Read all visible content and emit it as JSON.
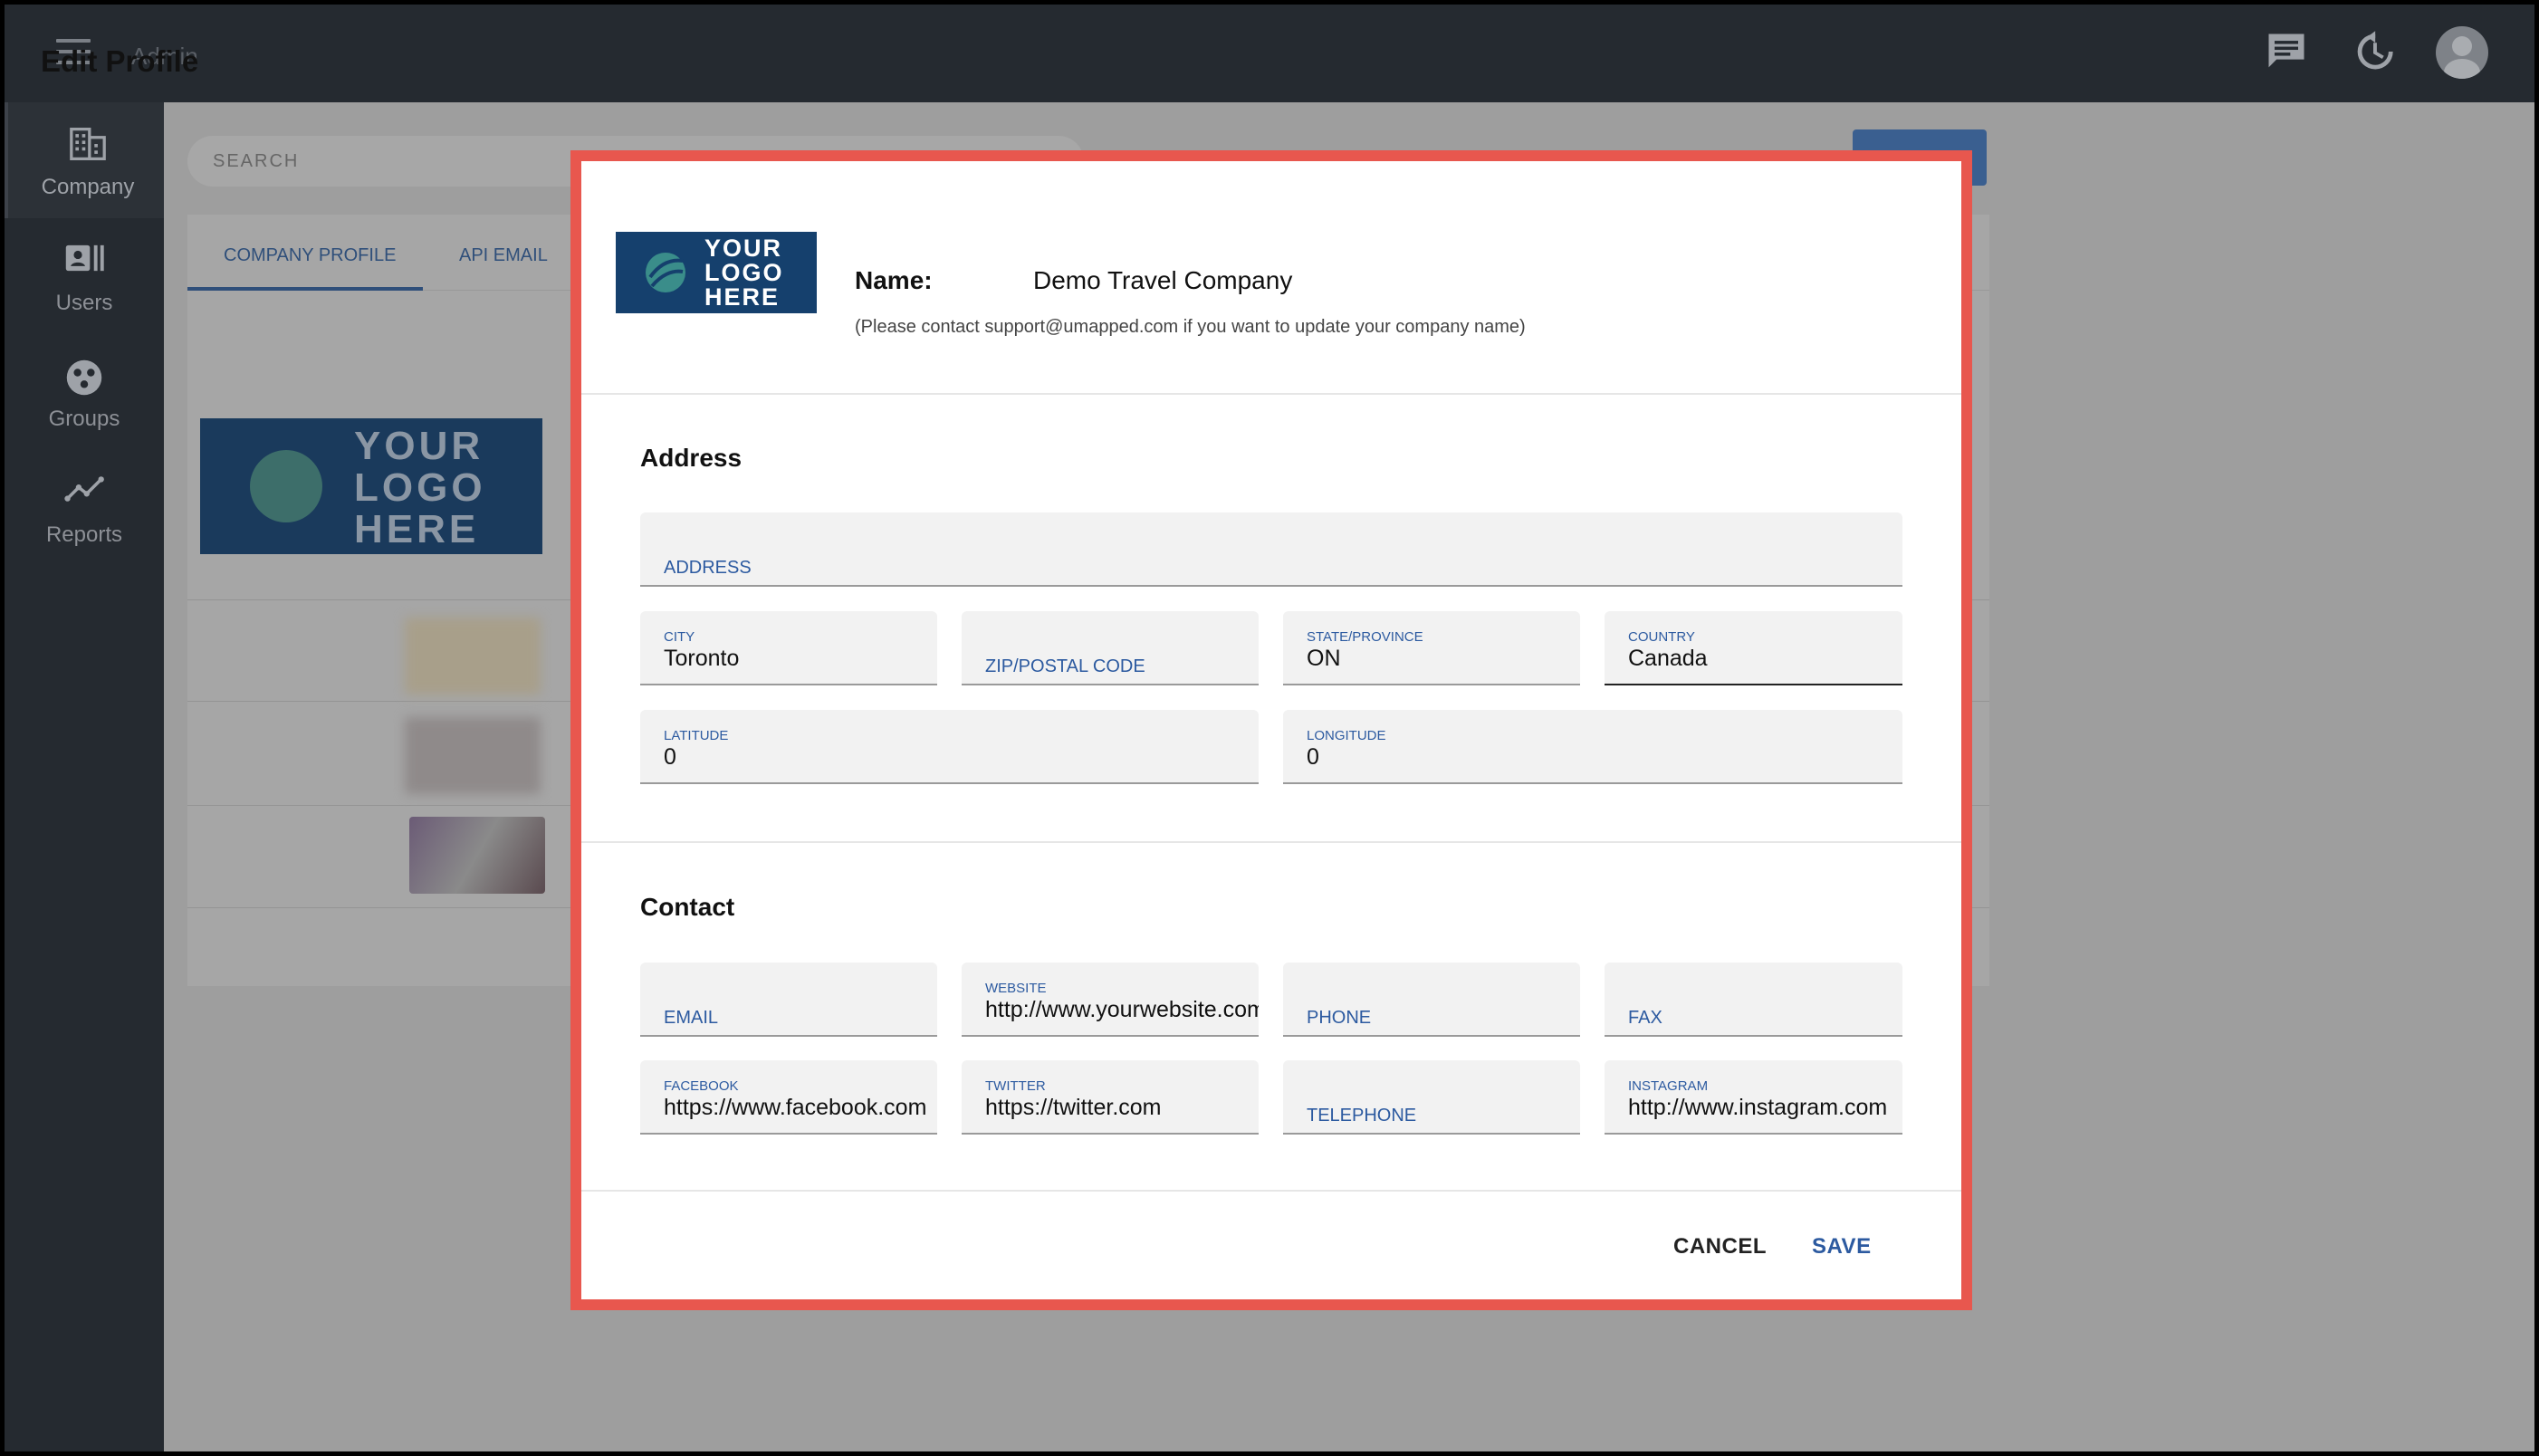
{
  "topbar": {
    "admin_text": "Admin",
    "page_title": "Edit Profile",
    "icons": [
      "chat-icon",
      "history-icon",
      "avatar"
    ]
  },
  "sidebar": {
    "items": [
      {
        "label": "Company",
        "icon": "building-icon"
      },
      {
        "label": "Users",
        "icon": "id-card-icon"
      },
      {
        "label": "Groups",
        "icon": "groups-icon"
      },
      {
        "label": "Reports",
        "icon": "chart-line-icon"
      }
    ]
  },
  "background": {
    "search_placeholder": "SEARCH",
    "tabs": [
      {
        "label": "COMPANY PROFILE"
      },
      {
        "label": "API EMAIL"
      }
    ],
    "logo_text": "YOUR LOGO HERE"
  },
  "modal": {
    "logo_text": "YOUR LOGO HERE",
    "name_label": "Name:",
    "name_value": "Demo Travel Company",
    "name_note": "(Please contact support@umapped.com if you want to update your company name)",
    "address": {
      "title": "Address",
      "address_placeholder": "ADDRESS",
      "city_label": "CITY",
      "city_value": "Toronto",
      "zip_placeholder": "ZIP/POSTAL CODE",
      "state_label": "STATE/PROVINCE",
      "state_value": "ON",
      "country_label": "COUNTRY",
      "country_value": "Canada",
      "latitude_label": "LATITUDE",
      "latitude_value": "0",
      "longitude_label": "LONGITUDE",
      "longitude_value": "0"
    },
    "contact": {
      "title": "Contact",
      "email_placeholder": "EMAIL",
      "website_label": "WEBSITE",
      "website_value": "http://www.yourwebsite.com",
      "phone_placeholder": "PHONE",
      "fax_placeholder": "FAX",
      "facebook_label": "FACEBOOK",
      "facebook_value": "https://www.facebook.com",
      "twitter_label": "TWITTER",
      "twitter_value": "https://twitter.com",
      "telephone_placeholder": "TELEPHONE",
      "instagram_label": "INSTAGRAM",
      "instagram_value": "http://www.instagram.com"
    },
    "cancel_label": "CANCEL",
    "save_label": "SAVE"
  },
  "colors": {
    "accent": "#2c5aa0",
    "highlight_border": "#e8574e",
    "topbar": "#252a30"
  }
}
